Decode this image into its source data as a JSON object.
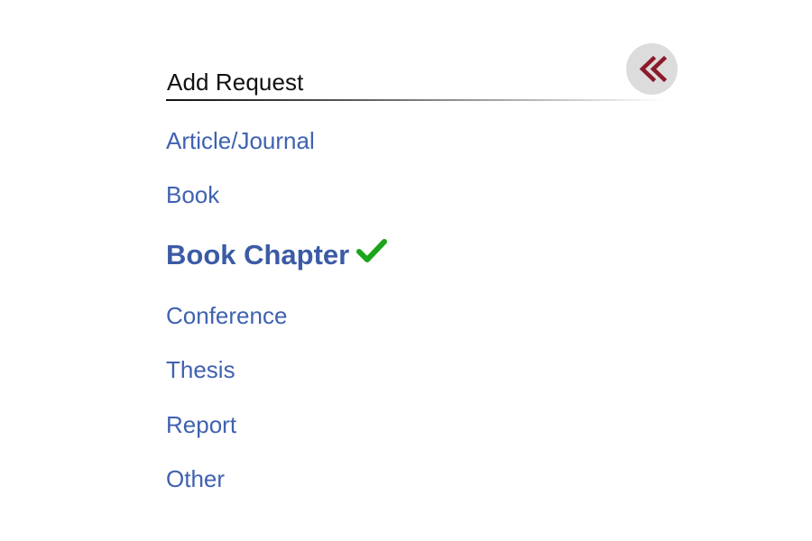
{
  "panel": {
    "title": "Add Request",
    "collapse_icon": "double-chevron-left-icon",
    "collapse_icon_color": "#8b1a2b"
  },
  "menu": {
    "link_color": "#3f62b0",
    "items": [
      {
        "label": "Article/Journal",
        "selected": false
      },
      {
        "label": "Book",
        "selected": false
      },
      {
        "label": "Book Chapter",
        "selected": true,
        "badge_icon": "checkmark-icon",
        "badge_color": "#1aa51a"
      },
      {
        "label": "Conference",
        "selected": false
      },
      {
        "label": "Thesis",
        "selected": false
      },
      {
        "label": "Report",
        "selected": false
      },
      {
        "label": "Other",
        "selected": false
      }
    ]
  }
}
